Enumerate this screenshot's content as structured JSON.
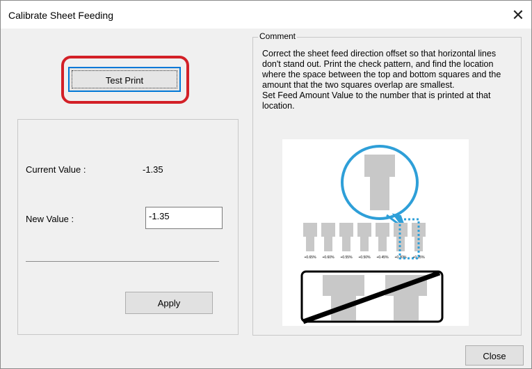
{
  "window": {
    "title": "Calibrate Sheet Feeding",
    "close_glyph": "✕"
  },
  "left_panel": {
    "test_print_label": "Test Print",
    "current_value_label": "Current Value :",
    "current_value": "-1.35",
    "new_value_label": "New Value :",
    "new_value": "-1.35",
    "apply_label": "Apply"
  },
  "comment": {
    "legend": "Comment",
    "paragraph1": "Correct the sheet feed direction offset so that horizontal lines don't stand out. Print the check pattern, and find the location where the space between the top and bottom squares and the amount that the two squares overlap are smallest.",
    "paragraph2": "Set Feed Amount Value to the number that is printed at that location.",
    "pattern_labels": [
      "+0.65%",
      "+0.60%",
      "+0.55%",
      "+0.50%",
      "+0.45%",
      "+0.40%",
      "+0.35%"
    ]
  },
  "footer": {
    "close_label": "Close"
  },
  "colors": {
    "highlight": "#d32027",
    "focus": "#0078d7",
    "callout": "#2e9fd8"
  }
}
